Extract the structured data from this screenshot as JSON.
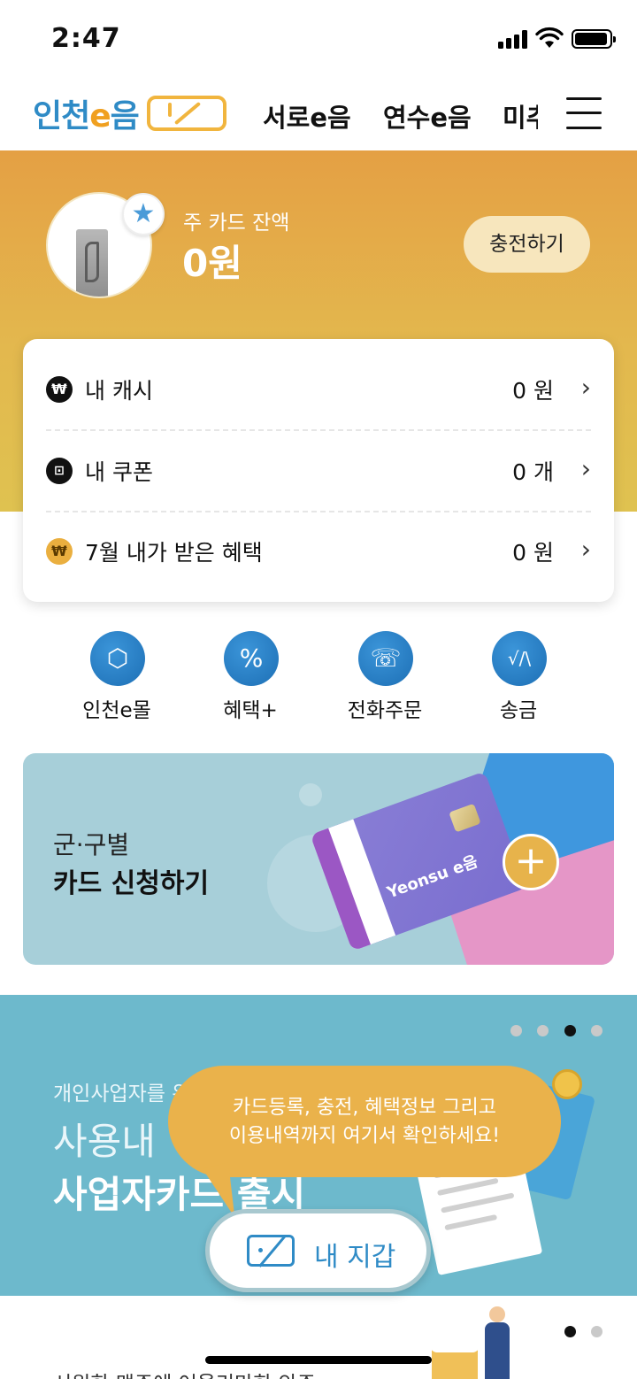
{
  "status_bar": {
    "time": "2:47"
  },
  "nav": {
    "logo_part1": "인천",
    "logo_e": "e",
    "logo_part2": "음",
    "tabs": [
      "서로e음",
      "연수e음",
      "미추"
    ]
  },
  "balance": {
    "label": "주 카드 잔액",
    "value": "0원",
    "charge_label": "충전하기"
  },
  "summary": {
    "rows": [
      {
        "icon": "won-icon",
        "icon_glyph": "₩",
        "label": "내 캐시",
        "value": "0 원"
      },
      {
        "icon": "coupon-icon",
        "icon_glyph": "⊡",
        "label": "내 쿠폰",
        "value": "0 개"
      },
      {
        "icon": "benefit-won-icon",
        "icon_glyph": "₩",
        "label": "7월 내가 받은 혜택",
        "value": "0 원"
      }
    ]
  },
  "quick_menu": [
    {
      "label": "인천e몰",
      "icon": "box-icon",
      "glyph": "⬡"
    },
    {
      "label": "혜택+",
      "icon": "percent-icon",
      "glyph": "%"
    },
    {
      "label": "전화주문",
      "icon": "phone-icon",
      "glyph": "☏"
    },
    {
      "label": "송금",
      "icon": "transfer-icon",
      "glyph": "√/\\"
    }
  ],
  "apply_banner": {
    "line1": "군·구별",
    "line2": "카드 신청하기",
    "card_brand": "Yeonsu e음"
  },
  "promo_banner": {
    "line1": "개인사업자를 위",
    "line2": "사용내",
    "line3": "사업자카드 출시",
    "slide_count": 4,
    "active_slide": 3
  },
  "tooltip": {
    "line1": "카드등록, 충전, 혜택정보 그리고",
    "line2": "이용내역까지 여기서 확인하세요!"
  },
  "wallet": {
    "label": "내 지갑"
  },
  "bottom": {
    "text": "시원한 맥주에 어울리만한 안주",
    "slide_count": 2,
    "active_slide": 1
  },
  "colors": {
    "accent_blue": "#2f8bc6",
    "hero_orange": "#e4a044",
    "hero_yellow": "#dfc250",
    "tooltip_gold": "#eab24b",
    "promo_teal": "#6db9cc"
  }
}
